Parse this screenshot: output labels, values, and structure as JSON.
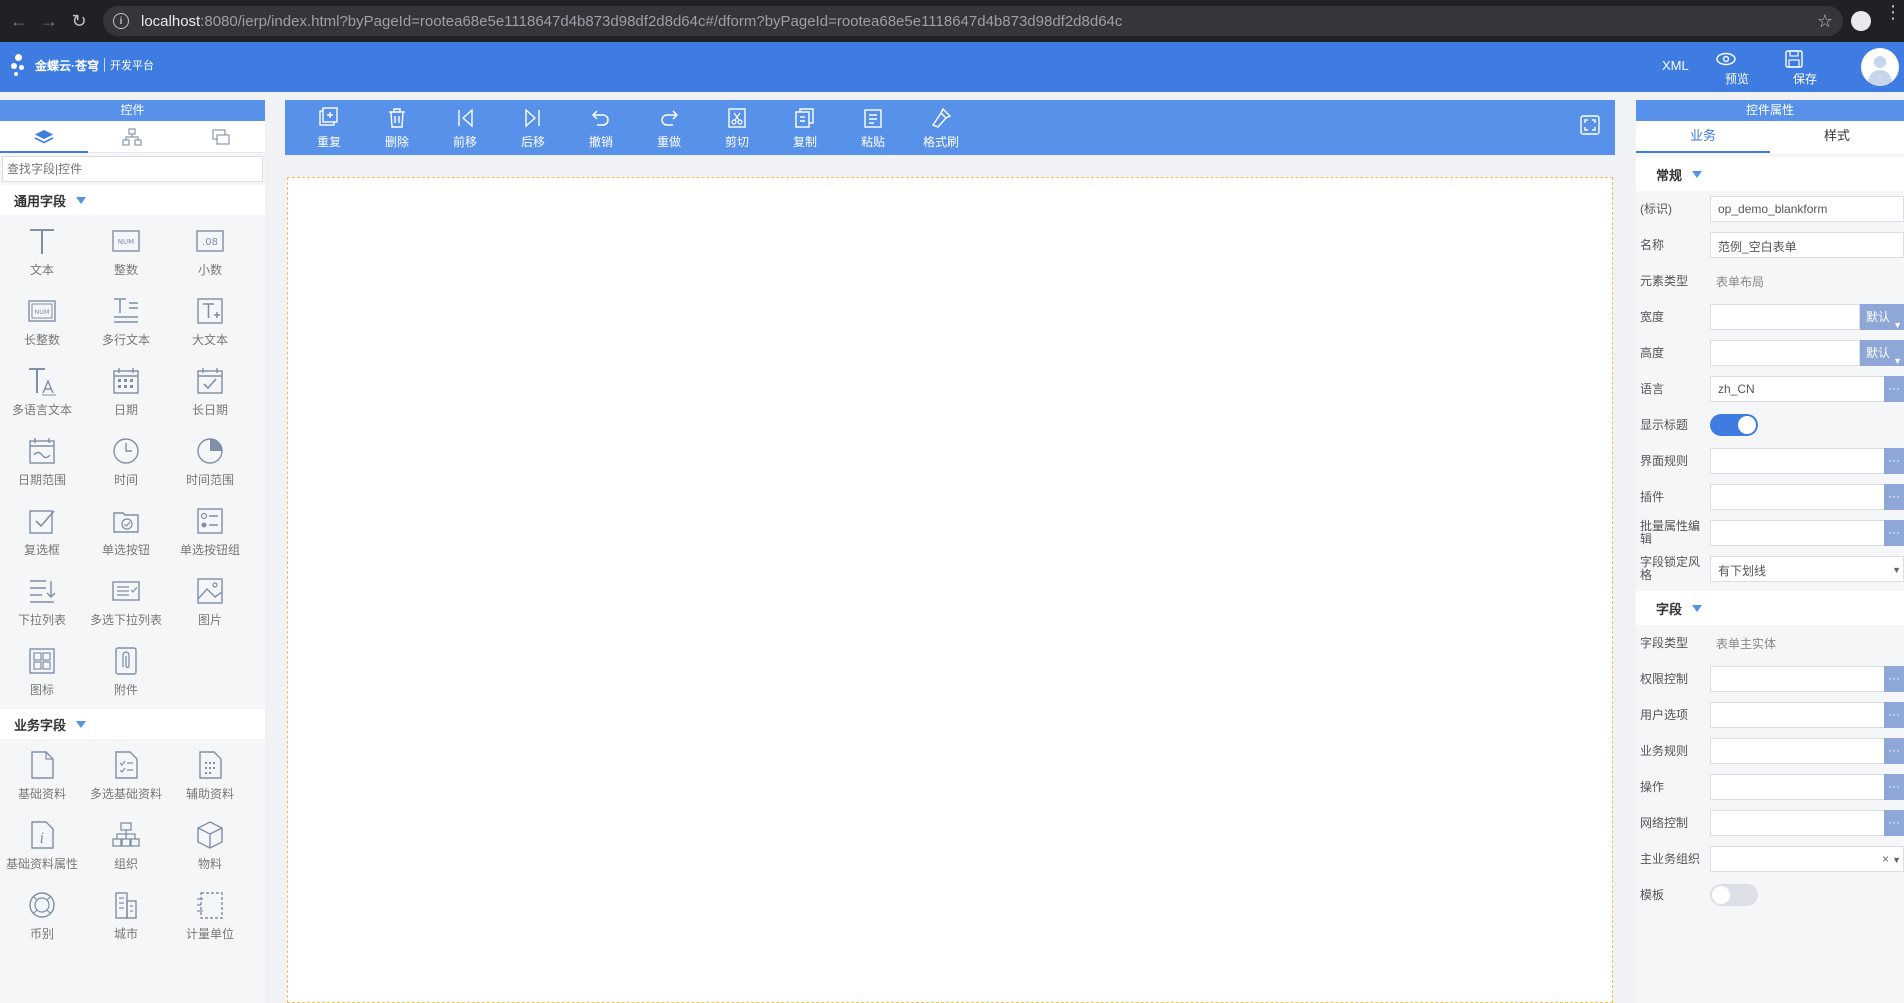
{
  "browser": {
    "url_host": "localhost",
    "url_rest": ":8080/ierp/index.html?byPageId=rootea68e5e1118647d4b873d98df2d8d64c#/dform?byPageId=rootea68e5e1118647d4b873d98df2d8d64c"
  },
  "header": {
    "logo_text": "金蝶云·苍穹",
    "logo_sub": "开发平台",
    "xml_label": "XML",
    "preview_label": "预览",
    "save_label": "保存"
  },
  "left_panel": {
    "title": "控件",
    "search_placeholder": "查找字段|控件",
    "groups": [
      {
        "title": "通用字段",
        "items": [
          "文本",
          "整数",
          "小数",
          "长整数",
          "多行文本",
          "大文本",
          "多语言文本",
          "日期",
          "长日期",
          "日期范围",
          "时间",
          "时间范围",
          "复选框",
          "单选按钮",
          "单选按钮组",
          "下拉列表",
          "多选下拉列表",
          "图片",
          "图标",
          "附件"
        ]
      },
      {
        "title": "业务字段",
        "items": [
          "基础资料",
          "多选基础资料",
          "辅助资料",
          "基础资料属性",
          "组织",
          "物料",
          "币别",
          "城市",
          "计量单位"
        ]
      }
    ]
  },
  "toolbar": {
    "items": [
      "重复",
      "删除",
      "前移",
      "后移",
      "撤销",
      "重做",
      "剪切",
      "复制",
      "粘贴",
      "格式刷"
    ]
  },
  "right_panel": {
    "title": "控件属性",
    "tabs": [
      "业务",
      "样式"
    ],
    "section_general": "常规",
    "section_field": "字段",
    "props": {
      "id_label": "(标识)",
      "id_value": "op_demo_blankform",
      "name_label": "名称",
      "name_value": "范例_空白表单",
      "element_type_label": "元素类型",
      "element_type_value": "表单布局",
      "width_label": "宽度",
      "height_label": "高度",
      "default_label": "默认",
      "language_label": "语言",
      "language_value": "zh_CN",
      "show_title_label": "显示标题",
      "ui_rules_label": "界面规则",
      "plugins_label": "插件",
      "batch_edit_label": "批量属性编辑",
      "lock_style_label": "字段锁定风格",
      "lock_style_value": "有下划线",
      "field_type_label": "字段类型",
      "field_type_value": "表单主实体",
      "permission_label": "权限控制",
      "user_option_label": "用户选项",
      "business_rules_label": "业务规则",
      "operations_label": "操作",
      "network_label": "网络控制",
      "main_org_label": "主业务组织",
      "template_label": "模板",
      "dots": "···"
    },
    "show_title_on": true,
    "template_on": false
  },
  "colors": {
    "header_blue": "#3e7ce2",
    "toolbar_blue": "#5891ea",
    "canvas_border": "#f0c34f"
  }
}
